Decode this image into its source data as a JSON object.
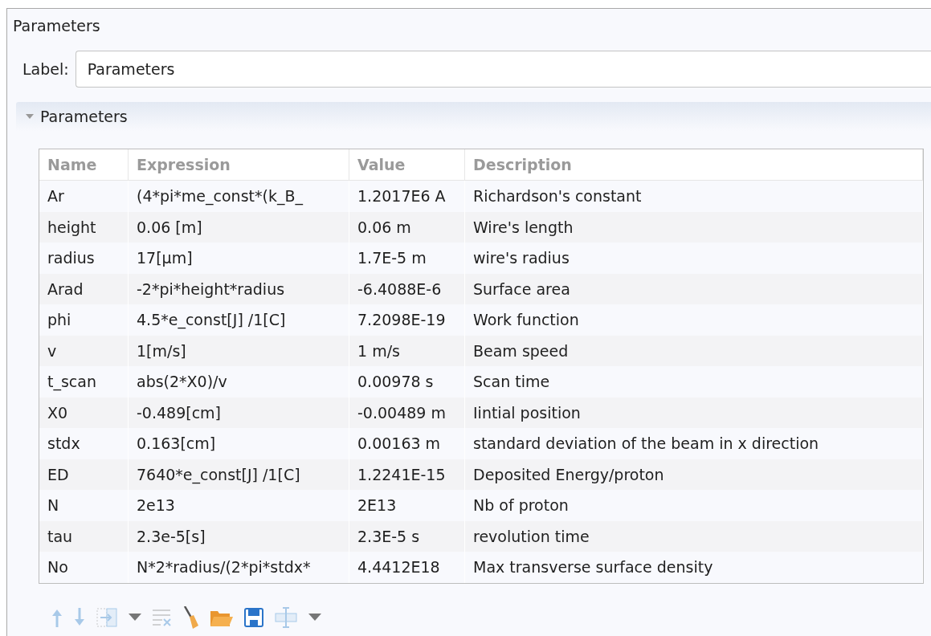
{
  "title": "Parameters",
  "label_field": {
    "label": "Label:",
    "value": "Parameters"
  },
  "section": {
    "title": "Parameters",
    "expanded": true
  },
  "table": {
    "columns": [
      "Name",
      "Expression",
      "Value",
      "Description"
    ],
    "rows": [
      [
        "Ar",
        "(4*pi*me_const*(k_B_",
        "1.2017E6 A",
        "Richardson's constant"
      ],
      [
        "height",
        "0.06 [m]",
        "0.06 m",
        "Wire's length"
      ],
      [
        "radius",
        "17[µm]",
        "1.7E-5 m",
        "wire's radius"
      ],
      [
        "Arad",
        "-2*pi*height*radius",
        "-6.4088E-6",
        "Surface area"
      ],
      [
        "phi",
        "4.5*e_const[J] /1[C]",
        "7.2098E-19",
        "Work function"
      ],
      [
        "v",
        "1[m/s]",
        "1 m/s",
        "Beam speed"
      ],
      [
        "t_scan",
        "abs(2*X0)/v",
        "0.00978 s",
        "Scan time"
      ],
      [
        "X0",
        "-0.489[cm]",
        "-0.00489 m",
        "Iintial position"
      ],
      [
        "stdx",
        "0.163[cm]",
        "0.00163 m",
        "standard deviation of the beam in x direction"
      ],
      [
        "ED",
        "7640*e_const[J] /1[C]",
        "1.2241E-15",
        "Deposited Energy/proton"
      ],
      [
        "N",
        "2e13",
        "2E13",
        "Nb of proton"
      ],
      [
        "tau",
        "2.3e-5[s]",
        "2.3E-5 s",
        "revolution time"
      ],
      [
        "No",
        "N*2*radius/(2*pi*stdx*",
        "4.4412E18",
        "Max transverse surface density"
      ]
    ]
  },
  "toolbar": [
    {
      "kind": "up",
      "disabled": true
    },
    {
      "kind": "down",
      "disabled": true
    },
    {
      "kind": "import",
      "disabled": true
    },
    {
      "kind": "dropdown",
      "disabled": false
    },
    {
      "kind": "clear",
      "disabled": true
    },
    {
      "kind": "broom",
      "disabled": false
    },
    {
      "kind": "open",
      "disabled": false
    },
    {
      "kind": "save",
      "disabled": false
    },
    {
      "kind": "field",
      "disabled": true
    },
    {
      "kind": "dropdown",
      "disabled": false
    }
  ]
}
